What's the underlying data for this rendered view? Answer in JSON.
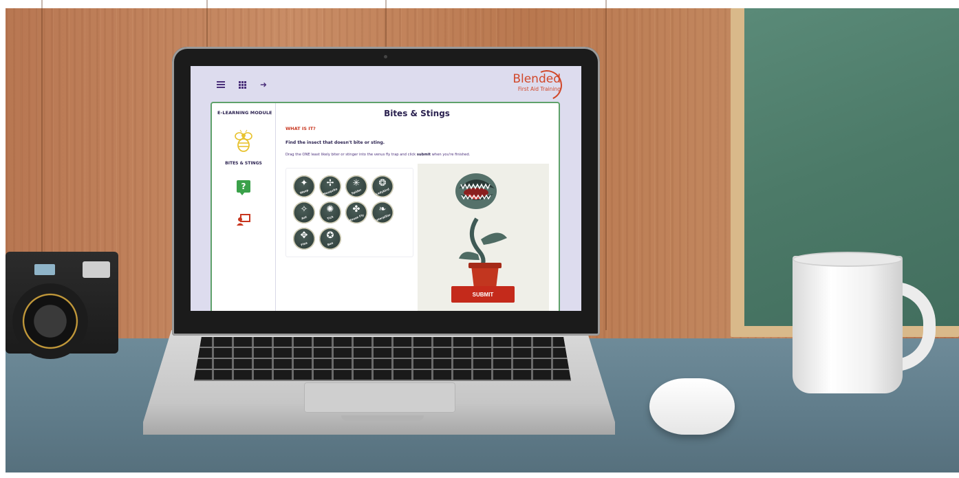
{
  "app": {
    "brand": "Blended",
    "brand_sub": "First Aid Training"
  },
  "sidebar": {
    "title": "E-LEARNING MODULE",
    "current_item": "BITES & STINGS"
  },
  "main": {
    "title": "Bites & Stings",
    "section_heading": "WHAT IS IT?",
    "question": "Find the insect that doesn't bite or sting.",
    "instruction_pre": "Drag the ONE least likely biter or stinger into the venus fly trap and click ",
    "instruction_bold": "submit",
    "instruction_post": " when you're finished.",
    "submit_label": "SUBMIT"
  },
  "insects": [
    {
      "label": "Wasp",
      "glyph": "✦"
    },
    {
      "label": "Mosquito",
      "glyph": "✢"
    },
    {
      "label": "Spider",
      "glyph": "✳"
    },
    {
      "label": "Ladybird",
      "glyph": "❂"
    },
    {
      "label": "Ant",
      "glyph": "✧"
    },
    {
      "label": "Tick",
      "glyph": "✺"
    },
    {
      "label": "House Fly",
      "glyph": "✤"
    },
    {
      "label": "Caterpillar",
      "glyph": "❧"
    },
    {
      "label": "Flea",
      "glyph": "✥"
    },
    {
      "label": "Bee",
      "glyph": "✪"
    }
  ],
  "colors": {
    "accent_purple": "#4a2f7a",
    "brand_red": "#d1482a",
    "panel_border": "#5ea16a",
    "submit": "#c42a1b",
    "quiz_green": "#3aa14a"
  }
}
